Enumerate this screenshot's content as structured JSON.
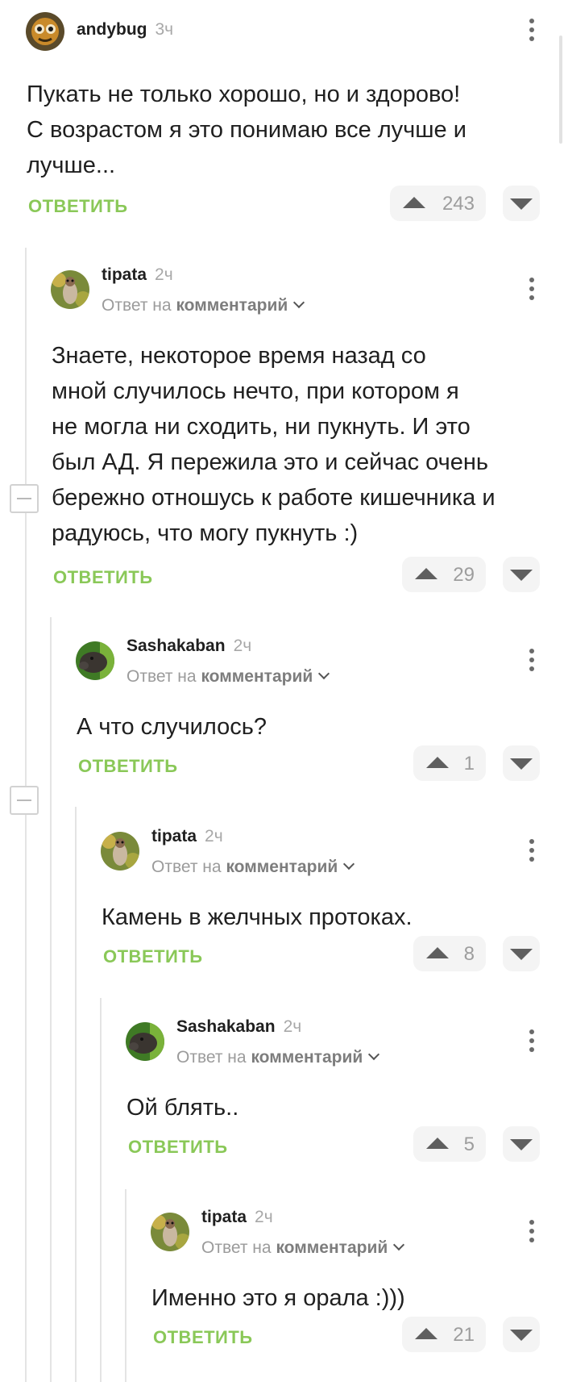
{
  "labels": {
    "reply_to_prefix": "Ответ на",
    "reply_to_target": "комментарий",
    "reply_button": "ОТВЕТИТЬ"
  },
  "comments": [
    {
      "user": "andybug",
      "time": "3ч",
      "text_lines": [
        "Пукать не только хорошо, но и здорово!",
        "С возрастом я это понимаю все лучше и",
        "лучше..."
      ],
      "votes": "243"
    },
    {
      "user": "tipata",
      "time": "2ч",
      "text_lines": [
        "Знаете, некоторое время назад со",
        "мной случилось нечто, при котором я",
        "не могла ни сходить, ни пукнуть. И это",
        "был АД. Я пережила это и сейчас очень",
        "бережно отношусь к работе кишечника и",
        "радуюсь, что могу пукнуть :)"
      ],
      "votes": "29"
    },
    {
      "user": "Sashakaban",
      "time": "2ч",
      "text_lines": [
        "А что случилось?"
      ],
      "votes": "1"
    },
    {
      "user": "tipata",
      "time": "2ч",
      "text_lines": [
        "Камень в желчных протоках."
      ],
      "votes": "8"
    },
    {
      "user": "Sashakaban",
      "time": "2ч",
      "text_lines": [
        "Ой блять.."
      ],
      "votes": "5"
    },
    {
      "user": "tipata",
      "time": "2ч",
      "text_lines": [
        "Именно это я орала :)))"
      ],
      "votes": "21"
    }
  ],
  "colors": {
    "reply_green": "#8ac858",
    "thread_line": "#e4e4e4"
  }
}
